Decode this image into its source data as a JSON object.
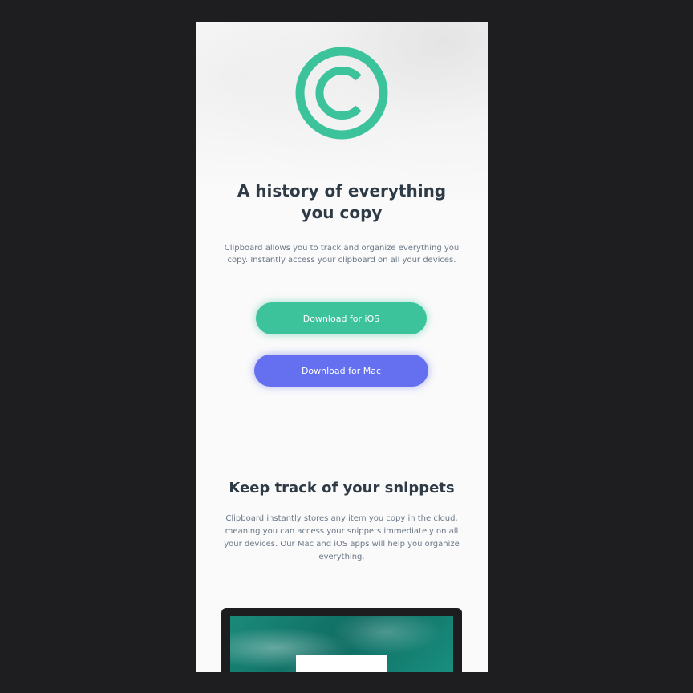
{
  "hero": {
    "logo_icon": "copyright-circle-icon",
    "title": "A history of everything you copy",
    "text": "Clipboard allows you to track and organize everything you copy. Instantly access your clipboard on all your devices.",
    "ios_button": "Download for iOS",
    "mac_button": "Download for Mac"
  },
  "snippets": {
    "title": "Keep track of your snippets",
    "text": "Clipboard instantly stores any item you copy in the cloud, meaning you can access your snippets immediately on all your devices. Our Mac and iOS apps will help you organize everything."
  },
  "colors": {
    "accent_green": "#3cc39c",
    "accent_blue": "#6470f0",
    "heading": "#2e3a45",
    "body_text": "#6b7786",
    "backdrop": "#1e1e20"
  }
}
